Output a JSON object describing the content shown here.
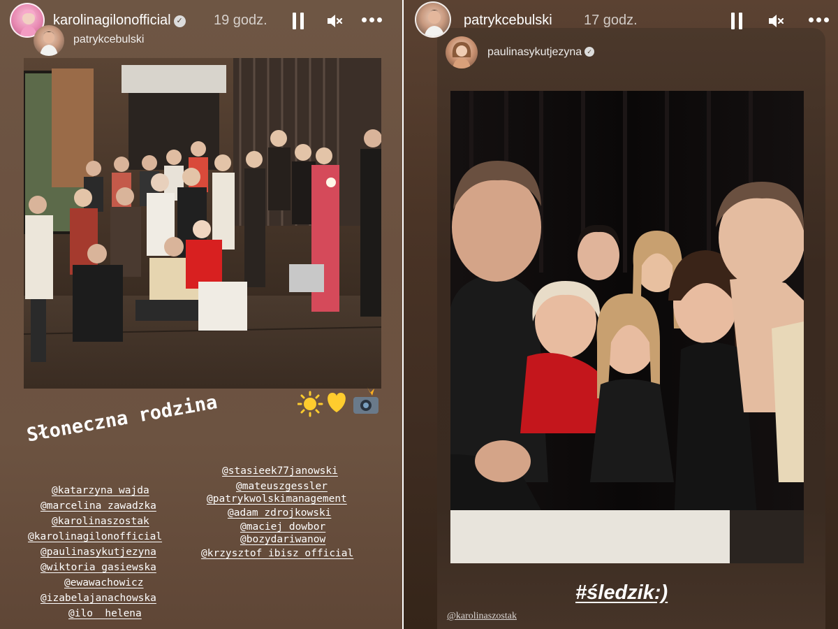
{
  "left_story": {
    "username": "karolinagilonofficial",
    "time": "19 godz.",
    "repost_username": "patrykcebulski",
    "caption": "Słoneczna rodzina",
    "mentions_left": [
      "@katarzyna_wajda",
      "@marcelina_zawadzka",
      "@karolinaszostak",
      "@karolinagilonofficial",
      "@paulinasykutjezyna",
      "@wiktoria_gasiewska",
      "@ewawachowicz",
      "@izabelajanachowska",
      "@ilo__helena"
    ],
    "mentions_right": [
      "@stasieek77janowski",
      "@mateuszgessler",
      "@patrykwolskimanagement",
      "@adam_zdrojkowski",
      "@maciej_dowbor",
      "@bozydariwanow",
      "@krzysztof_ibisz_official"
    ],
    "stickers": [
      "sun-emoji",
      "yellow-heart-emoji",
      "camera-flash-emoji"
    ]
  },
  "right_story": {
    "username": "patrykcebulski",
    "time": "17 godz.",
    "repost_username": "paulinasykutjezyna",
    "hashtag": "#śledzik:)",
    "bottom_mention": "@karolinaszostak"
  },
  "colors": {
    "left_background": "#6c5341",
    "right_background": "#3e2c21",
    "text": "#ffffff",
    "divider": "#ffffff"
  }
}
